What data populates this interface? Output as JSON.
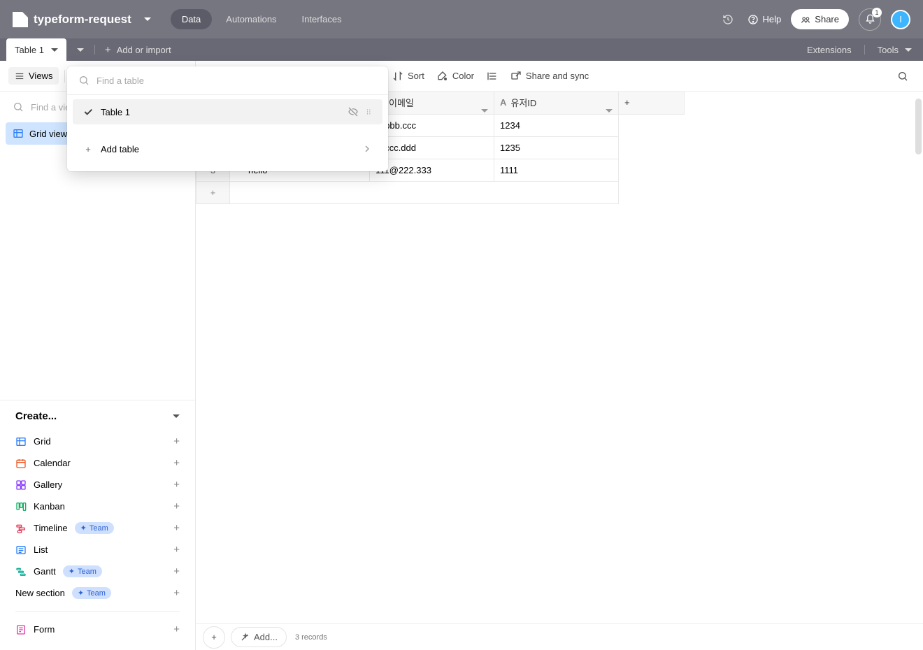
{
  "header": {
    "base_name": "typeform-request",
    "tabs": [
      "Data",
      "Automations",
      "Interfaces"
    ],
    "help_label": "Help",
    "share_label": "Share",
    "notif_count": "1",
    "avatar_initial": "I"
  },
  "table_bar": {
    "active_table": "Table 1",
    "add_import": "Add or import",
    "extensions": "Extensions",
    "tools": "Tools"
  },
  "view_toolbar": {
    "views": "Views",
    "sort": "Sort",
    "color": "Color",
    "share_sync": "Share and sync"
  },
  "sidebar": {
    "find_placeholder": "Find a view",
    "active_view": "Grid view"
  },
  "create": {
    "header": "Create...",
    "grid": "Grid",
    "calendar": "Calendar",
    "gallery": "Gallery",
    "kanban": "Kanban",
    "timeline": "Timeline",
    "list": "List",
    "gantt": "Gantt",
    "new_section": "New section",
    "form": "Form",
    "team_badge": "Team"
  },
  "columns": {
    "email": "이메일",
    "userid": "유저ID"
  },
  "rows": [
    {
      "n": "3",
      "name": "hello",
      "email": "111@222.333",
      "userid": "1111"
    }
  ],
  "visible_cells": {
    "r1_email": "@bbb.ccc",
    "r1_uid": "1234",
    "r2_email": "@ccc.ddd",
    "r2_uid": "1235"
  },
  "footer": {
    "add": "Add...",
    "records": "3 records"
  },
  "popover": {
    "placeholder": "Find a table",
    "item": "Table 1",
    "add_table": "Add table"
  }
}
